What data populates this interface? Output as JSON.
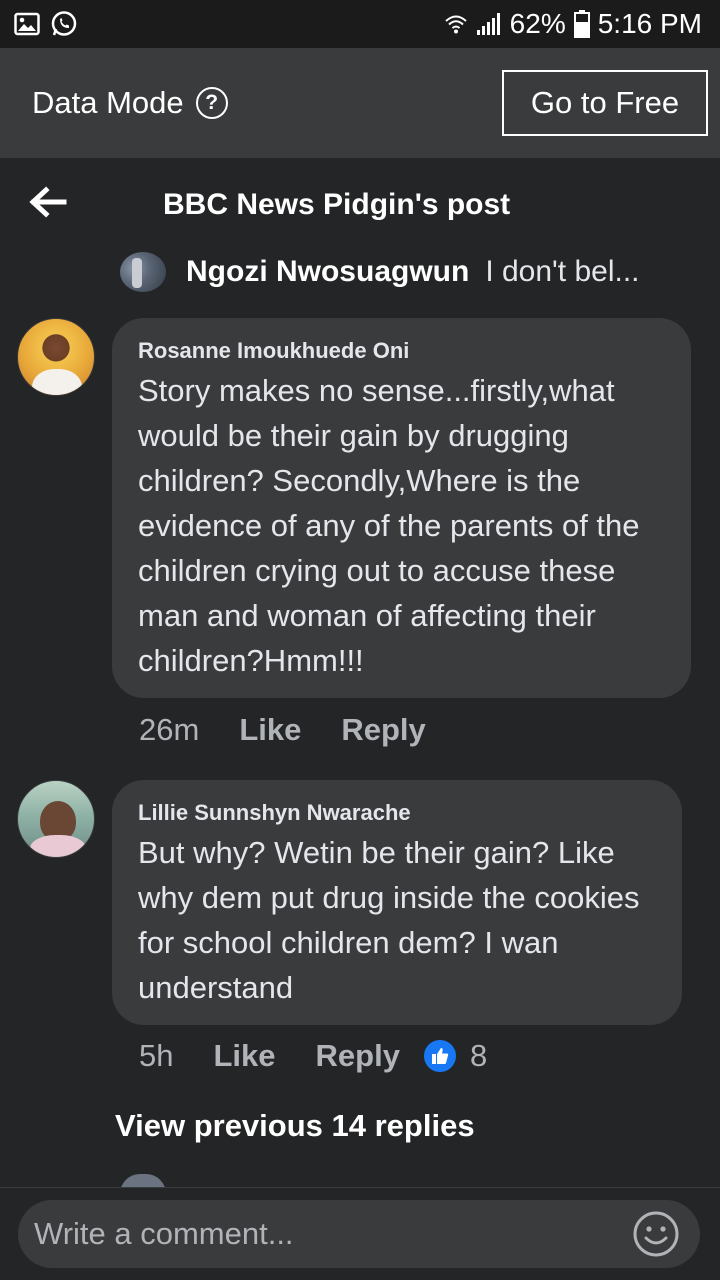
{
  "status_bar": {
    "battery": "62%",
    "time": "5:16 PM"
  },
  "data_mode": {
    "label": "Data Mode",
    "button": "Go to Free"
  },
  "header": {
    "title": "BBC News Pidgin's post"
  },
  "parent_reply": {
    "name": "Ngozi Nwosuagwun",
    "text": "I don't bel..."
  },
  "comments": [
    {
      "name": "Rosanne Imoukhuede Oni",
      "text": "Story makes no sense...firstly,what would be their gain by drugging children? Secondly,Where is the evidence of any of the parents of the children crying out to accuse these man and woman of affecting their children?Hmm!!!",
      "time": "26m",
      "like_label": "Like",
      "reply_label": "Reply"
    },
    {
      "name": "Lillie Sunnshyn Nwarache",
      "text": "But why? Wetin be their gain? Like why dem put drug inside the cookies for school children dem? I wan understand",
      "time": "5h",
      "like_label": "Like",
      "reply_label": "Reply",
      "reaction_count": "8"
    }
  ],
  "view_previous": "View previous 14 replies",
  "composer": {
    "placeholder": "Write a comment..."
  },
  "colors": {
    "background": "#242526",
    "bubble": "#3a3b3c",
    "banner": "#3a3b3c",
    "status_bar": "#1b1b1c",
    "like_blue": "#1877f2",
    "secondary_text": "#b0b3b8"
  }
}
